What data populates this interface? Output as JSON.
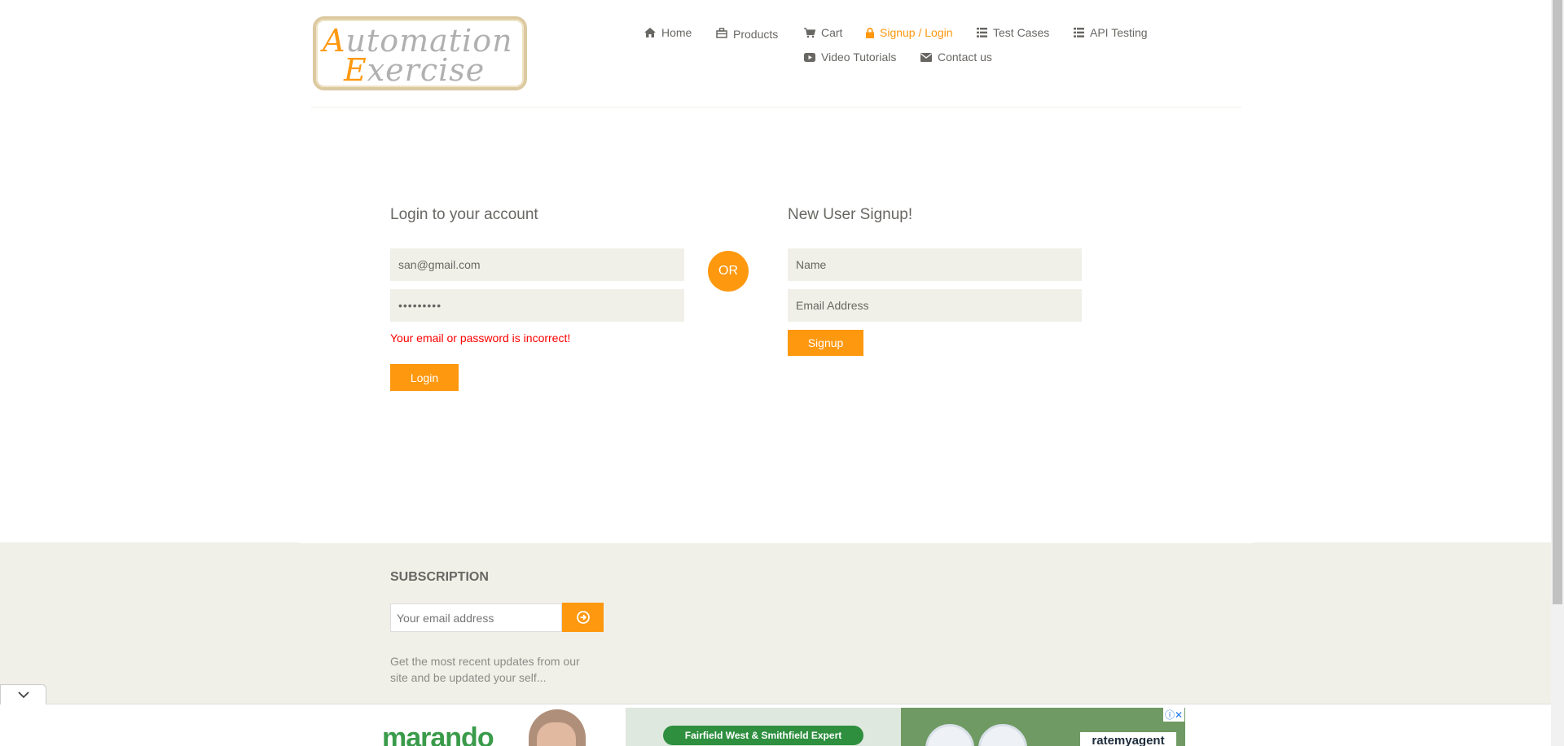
{
  "logo": {
    "line1_initial": "A",
    "line1_rest": "utomation",
    "line2_initial": "E",
    "line2_rest": "xercise"
  },
  "nav": {
    "items": [
      {
        "label": "Home",
        "icon": "home-icon"
      },
      {
        "label": "Products",
        "icon": "products-icon"
      },
      {
        "label": "Cart",
        "icon": "cart-icon"
      },
      {
        "label": "Signup / Login",
        "icon": "lock-icon",
        "active": true
      },
      {
        "label": "Test Cases",
        "icon": "list-icon"
      },
      {
        "label": "API Testing",
        "icon": "list-icon"
      },
      {
        "label": "Video Tutorials",
        "icon": "youtube-icon"
      },
      {
        "label": "Contact us",
        "icon": "envelope-icon"
      }
    ]
  },
  "login": {
    "title": "Login to your account",
    "email_value": "san@gmail.com",
    "password_value": "•••••••••",
    "error": "Your email or password is incorrect!",
    "button": "Login"
  },
  "or_label": "OR",
  "signup": {
    "title": "New User Signup!",
    "name_placeholder": "Name",
    "email_placeholder": "Email Address",
    "button": "Signup"
  },
  "footer": {
    "subscription_title": "SUBSCRIPTION",
    "email_placeholder": "Your email address",
    "text": "Get the most recent updates from our site and be updated your self..."
  },
  "ad": {
    "brand": "marando",
    "pill": "Fairfield West & Smithfield Expert",
    "rate": "ratemyagent"
  },
  "colors": {
    "accent": "#fe980f",
    "error": "#ff0000",
    "field_bg": "#f0f0e9"
  }
}
